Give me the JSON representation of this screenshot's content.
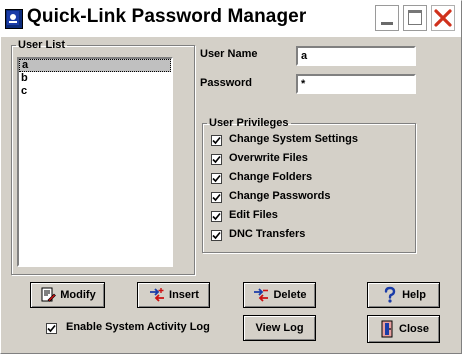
{
  "window": {
    "title": "Quick-Link Password Manager"
  },
  "user_list": {
    "label": "User List",
    "items": [
      {
        "name": "a",
        "selected": true
      },
      {
        "name": "b",
        "selected": false
      },
      {
        "name": "c",
        "selected": false
      }
    ]
  },
  "form": {
    "username_label": "User Name",
    "username_value": "a",
    "password_label": "Password",
    "password_value": "*"
  },
  "privileges": {
    "label": "User Privileges",
    "items": [
      {
        "label": "Change System Settings",
        "checked": true
      },
      {
        "label": "Overwrite Files",
        "checked": true
      },
      {
        "label": "Change Folders",
        "checked": true
      },
      {
        "label": "Change Passwords",
        "checked": true
      },
      {
        "label": "Edit Files",
        "checked": true
      },
      {
        "label": "DNC Transfers",
        "checked": true
      }
    ]
  },
  "buttons": {
    "modify": "Modify",
    "insert": "Insert",
    "delete": "Delete",
    "help": "Help",
    "view_log": "View Log",
    "close": "Close"
  },
  "activity_log": {
    "label": "Enable System Activity Log",
    "checked": true
  },
  "icons": {
    "app": "app-window-icon",
    "minimize": "minimize-icon",
    "maximize": "maximize-icon",
    "close": "close-icon",
    "modify": "modify-document-icon",
    "insert": "insert-arrows-icon",
    "delete": "delete-arrows-icon",
    "help": "question-mark-icon",
    "close_door": "door-exit-icon"
  },
  "colors": {
    "face": "#d4d0c8",
    "close_x": "#d0311c",
    "accent_blue": "#1a3ca8",
    "accent_red": "#cc1111"
  }
}
